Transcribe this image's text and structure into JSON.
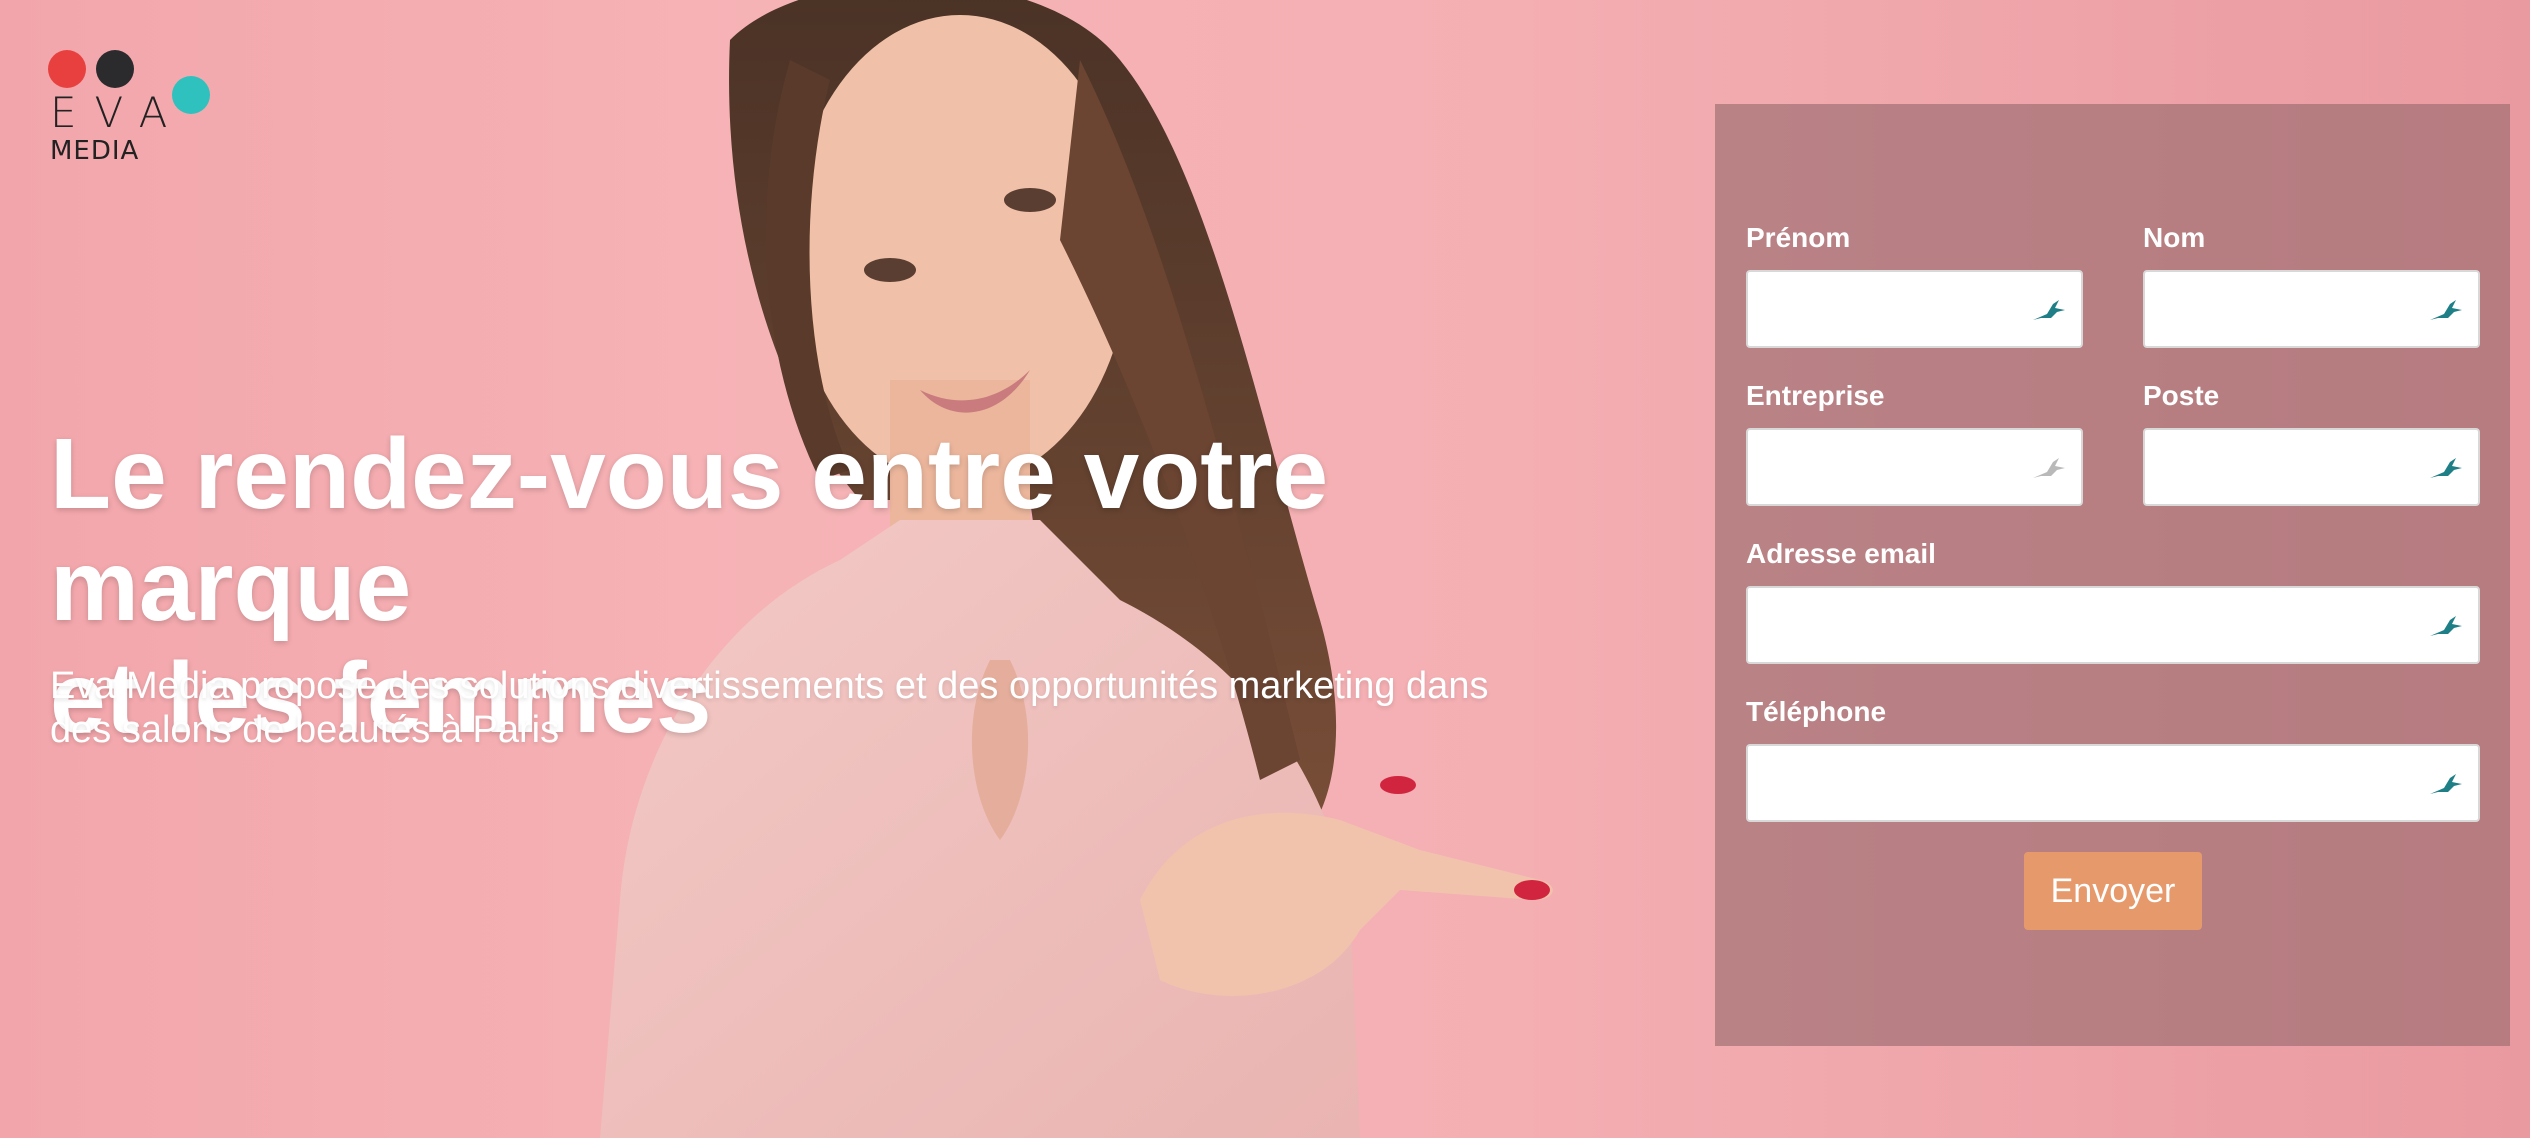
{
  "brand": {
    "logo_word": "EVA",
    "logo_sub": "MEDIA",
    "colors": {
      "red": "#e8403f",
      "dark": "#2b2b2e",
      "teal": "#2fc1be"
    }
  },
  "hero": {
    "headline_line1": "Le rendez-vous entre votre marque",
    "headline_line2": "et les femmes",
    "subline_line1": "Eva Media propose des solutions divertissements et des opportunités marketing dans",
    "subline_line2": "des salons de beautés à Paris"
  },
  "form": {
    "fields": [
      {
        "label": "Prénom",
        "value": "",
        "icon": "autofill-icon"
      },
      {
        "label": "Nom",
        "value": "",
        "icon": "autofill-icon"
      },
      {
        "label": "Entreprise",
        "value": "",
        "icon": "autofill-icon-inactive"
      },
      {
        "label": "Poste",
        "value": "",
        "icon": "autofill-icon"
      },
      {
        "label": "Adresse email",
        "value": "",
        "icon": "autofill-icon"
      },
      {
        "label": "Téléphone",
        "value": "",
        "icon": "autofill-icon"
      }
    ],
    "submit_label": "Envoyer",
    "accent_color": "#e69a6c"
  }
}
